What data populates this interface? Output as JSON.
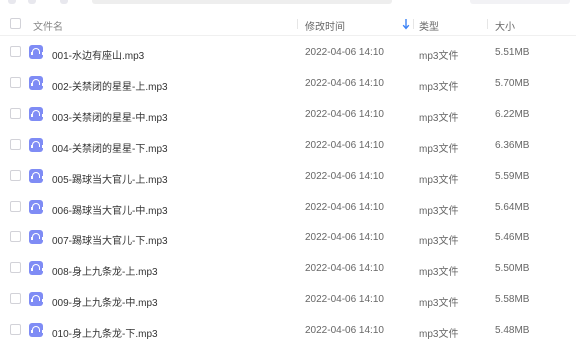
{
  "header": {
    "name_label": "文件名",
    "date_label": "修改时间",
    "type_label": "类型",
    "size_label": "大小"
  },
  "files": [
    {
      "name": "001-水边有座山.mp3",
      "date": "2022-04-06 14:10",
      "type": "mp3文件",
      "size": "5.51MB"
    },
    {
      "name": "002-关禁闭的星星-上.mp3",
      "date": "2022-04-06 14:10",
      "type": "mp3文件",
      "size": "5.70MB"
    },
    {
      "name": "003-关禁闭的星星-中.mp3",
      "date": "2022-04-06 14:10",
      "type": "mp3文件",
      "size": "6.22MB"
    },
    {
      "name": "004-关禁闭的星星-下.mp3",
      "date": "2022-04-06 14:10",
      "type": "mp3文件",
      "size": "6.36MB"
    },
    {
      "name": "005-踢球当大官儿-上.mp3",
      "date": "2022-04-06 14:10",
      "type": "mp3文件",
      "size": "5.59MB"
    },
    {
      "name": "006-踢球当大官儿-中.mp3",
      "date": "2022-04-06 14:10",
      "type": "mp3文件",
      "size": "5.64MB"
    },
    {
      "name": "007-踢球当大官儿-下.mp3",
      "date": "2022-04-06 14:10",
      "type": "mp3文件",
      "size": "5.46MB"
    },
    {
      "name": "008-身上九条龙-上.mp3",
      "date": "2022-04-06 14:10",
      "type": "mp3文件",
      "size": "5.50MB"
    },
    {
      "name": "009-身上九条龙-中.mp3",
      "date": "2022-04-06 14:10",
      "type": "mp3文件",
      "size": "5.58MB"
    },
    {
      "name": "010-身上九条龙-下.mp3",
      "date": "2022-04-06 14:10",
      "type": "mp3文件",
      "size": "5.48MB"
    }
  ],
  "colors": {
    "file_icon": "#7f8cf5",
    "sort_arrow": "#3b82f6"
  },
  "icons": {
    "file": "audio-file-icon",
    "sort": "sort-desc-icon"
  }
}
